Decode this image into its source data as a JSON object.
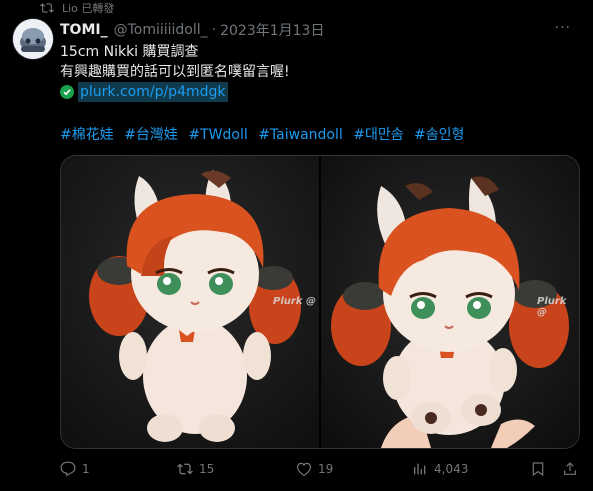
{
  "retweet": {
    "text": "Lio 已轉發"
  },
  "tweet": {
    "name": "TOMI_",
    "handle": "@Tomiiiiidoll_",
    "dot": "·",
    "date": "2023年1月13日",
    "more_label": "···",
    "lines": [
      "15cm Nikki 購買調查",
      "有興趣購買的話可以到匿名噗留言喔!"
    ],
    "link": "plurk.com/p/p4mdgk",
    "hashtags": [
      "#棉花娃",
      "#台灣娃",
      "#TWdoll",
      "#Taiwandoll",
      "#대만솜",
      "#솜인형"
    ],
    "watermark": "Plurk @"
  },
  "actions": {
    "replies": "1",
    "retweets": "15",
    "likes": "19",
    "views": "4,043"
  },
  "colors": {
    "link": "#1d9bf0",
    "muted": "#71767b",
    "text": "#e7e9ea",
    "hair": "#d9521f"
  },
  "icons": [
    "retweet-icon",
    "verified-link-icon",
    "reply-icon",
    "like-icon",
    "views-icon",
    "bookmark-icon",
    "share-icon"
  ]
}
